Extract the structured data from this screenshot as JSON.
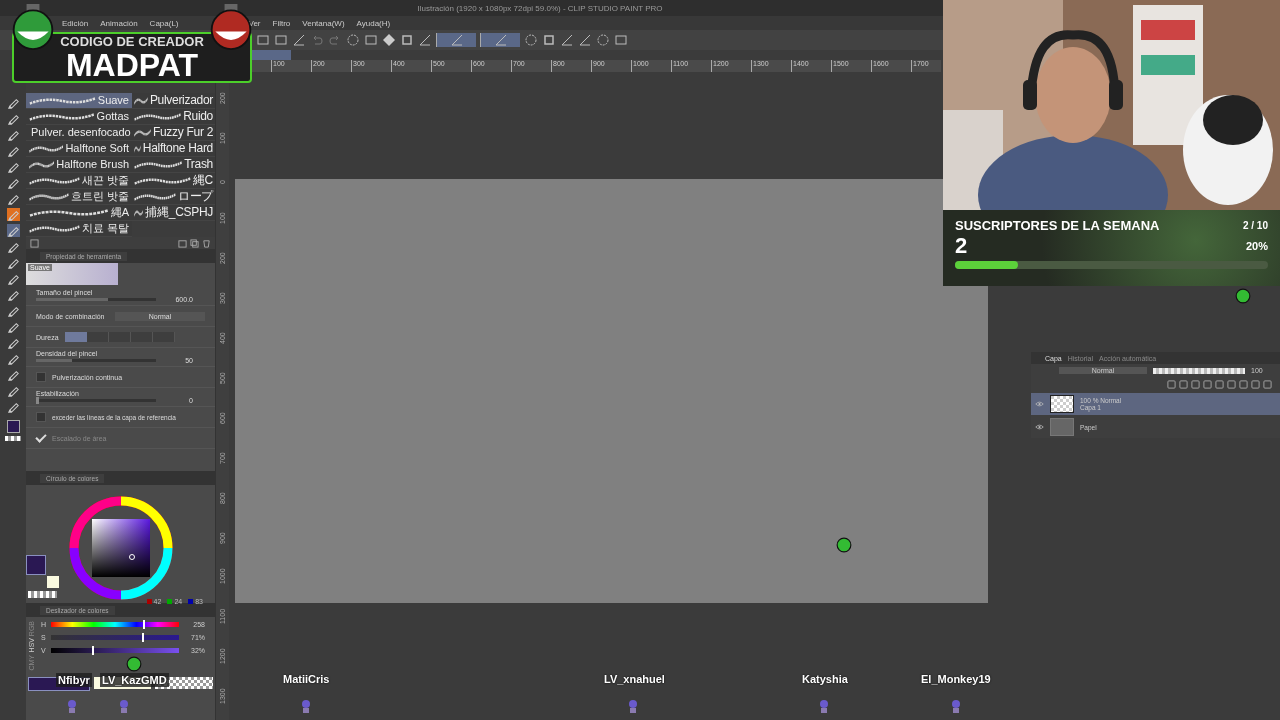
{
  "window": {
    "title": "Ilustración (1920 x 1080px 72dpi 59.0%)  - CLIP STUDIO PAINT PRO"
  },
  "menu": [
    "Edición",
    "Animación",
    "Capa(L)",
    "Ver",
    "Filtro",
    "Ventana(W)",
    "Ayuda(H)"
  ],
  "overlay_logo": {
    "line_1": "CODIGO DE CREADOR",
    "line_2": "MADPAT"
  },
  "rulers": {
    "horizontal": [
      "100",
      "200",
      "300",
      "400",
      "500",
      "600",
      "700",
      "800",
      "900",
      "1000",
      "1100",
      "1200",
      "1300",
      "1400",
      "1500",
      "1600",
      "1700"
    ],
    "vertical": [
      "200",
      "100",
      "0",
      "100",
      "200",
      "300",
      "400",
      "500",
      "600",
      "700",
      "800",
      "900",
      "1000",
      "1100",
      "1200",
      "1300"
    ]
  },
  "brushes": [
    {
      "name": "Suave",
      "selected": true
    },
    {
      "name": "Pulverizador",
      "selected": false
    },
    {
      "name": "Gottas",
      "selected": false
    },
    {
      "name": "Ruido",
      "selected": false
    },
    {
      "name": "Pulver. desenfocado",
      "selected": false
    },
    {
      "name": "Fuzzy Fur 2",
      "selected": false
    },
    {
      "name": "Halftone Soft",
      "selected": false
    },
    {
      "name": "Halftone Hard",
      "selected": false
    },
    {
      "name": "Halftone Brush",
      "selected": false
    },
    {
      "name": "Trash",
      "selected": false
    },
    {
      "name": "새끈 밧줄",
      "selected": false
    },
    {
      "name": "縄C",
      "selected": false
    },
    {
      "name": "흐트린 밧줄",
      "selected": false
    },
    {
      "name": "ロープ",
      "selected": false
    },
    {
      "name": "縄A",
      "selected": false
    },
    {
      "name": "捕縄_CSPHJ",
      "selected": false
    },
    {
      "name": "치료 목탈",
      "selected": false
    }
  ],
  "tool_property": {
    "title": "Propiedad de herramienta",
    "preview_label": "Suave",
    "brush_size": {
      "label": "Tamaño del pincel",
      "value": "600.0",
      "level": 0.6
    },
    "blend_mode": {
      "label": "Modo de combinación",
      "value": "Normal"
    },
    "hardness": {
      "label": "Dureza",
      "level": 0.2
    },
    "density": {
      "label": "Densidad del pincel",
      "value": "50",
      "level": 0.3
    },
    "continuous_spray": {
      "label": "Pulverización continua",
      "checked": false
    },
    "stabilization": {
      "label": "Estabilización",
      "value": "0",
      "level": 0
    },
    "reference_lines": {
      "label": "exceder las líneas de la capa de referencia",
      "checked": false
    },
    "area_scaling": {
      "label": "Escalado de área",
      "checked": true,
      "disabled": true
    }
  },
  "color_wheel": {
    "title": "Círculo de colores",
    "r": "42",
    "g": "24",
    "b": "83"
  },
  "color_slider": {
    "title": "Deslizador de colores",
    "modes": [
      {
        "label": "RGB",
        "selected": false
      },
      {
        "label": "HSV",
        "selected": true
      },
      {
        "label": "CMY",
        "selected": false
      }
    ],
    "channels": [
      {
        "name": "H",
        "value": "258",
        "level": 0.72
      },
      {
        "name": "S",
        "value": "71%",
        "level": 0.71
      },
      {
        "name": "V",
        "value": "32%",
        "level": 0.32
      }
    ]
  },
  "layer_panel": {
    "tabs": [
      {
        "label": "Capa",
        "selected": true
      },
      {
        "label": "Historial",
        "selected": false
      },
      {
        "label": "Acción automática",
        "selected": false
      }
    ],
    "blend_mode": "Normal",
    "opacity": {
      "value": "100",
      "level": 1
    },
    "layers": [
      {
        "line_1": "100 % Normal",
        "line_2": "Capa 1",
        "visible": true,
        "selected": true
      },
      {
        "line_1": "Papel",
        "visible": true,
        "selected": false
      }
    ]
  },
  "sub_goal": {
    "title": "SUSCRIPTORES DE LA SEMANA",
    "count": "2",
    "ratio": "2 / 10",
    "percent": "20%",
    "level": 0.2
  },
  "chat_names": [
    {
      "name": "Nfibyr"
    },
    {
      "name": "LV_KazGMD"
    },
    {
      "name": "MatiiCris"
    },
    {
      "name": "LV_xnahuel"
    },
    {
      "name": "Katyshia"
    },
    {
      "name": "El_Monkey19"
    }
  ]
}
